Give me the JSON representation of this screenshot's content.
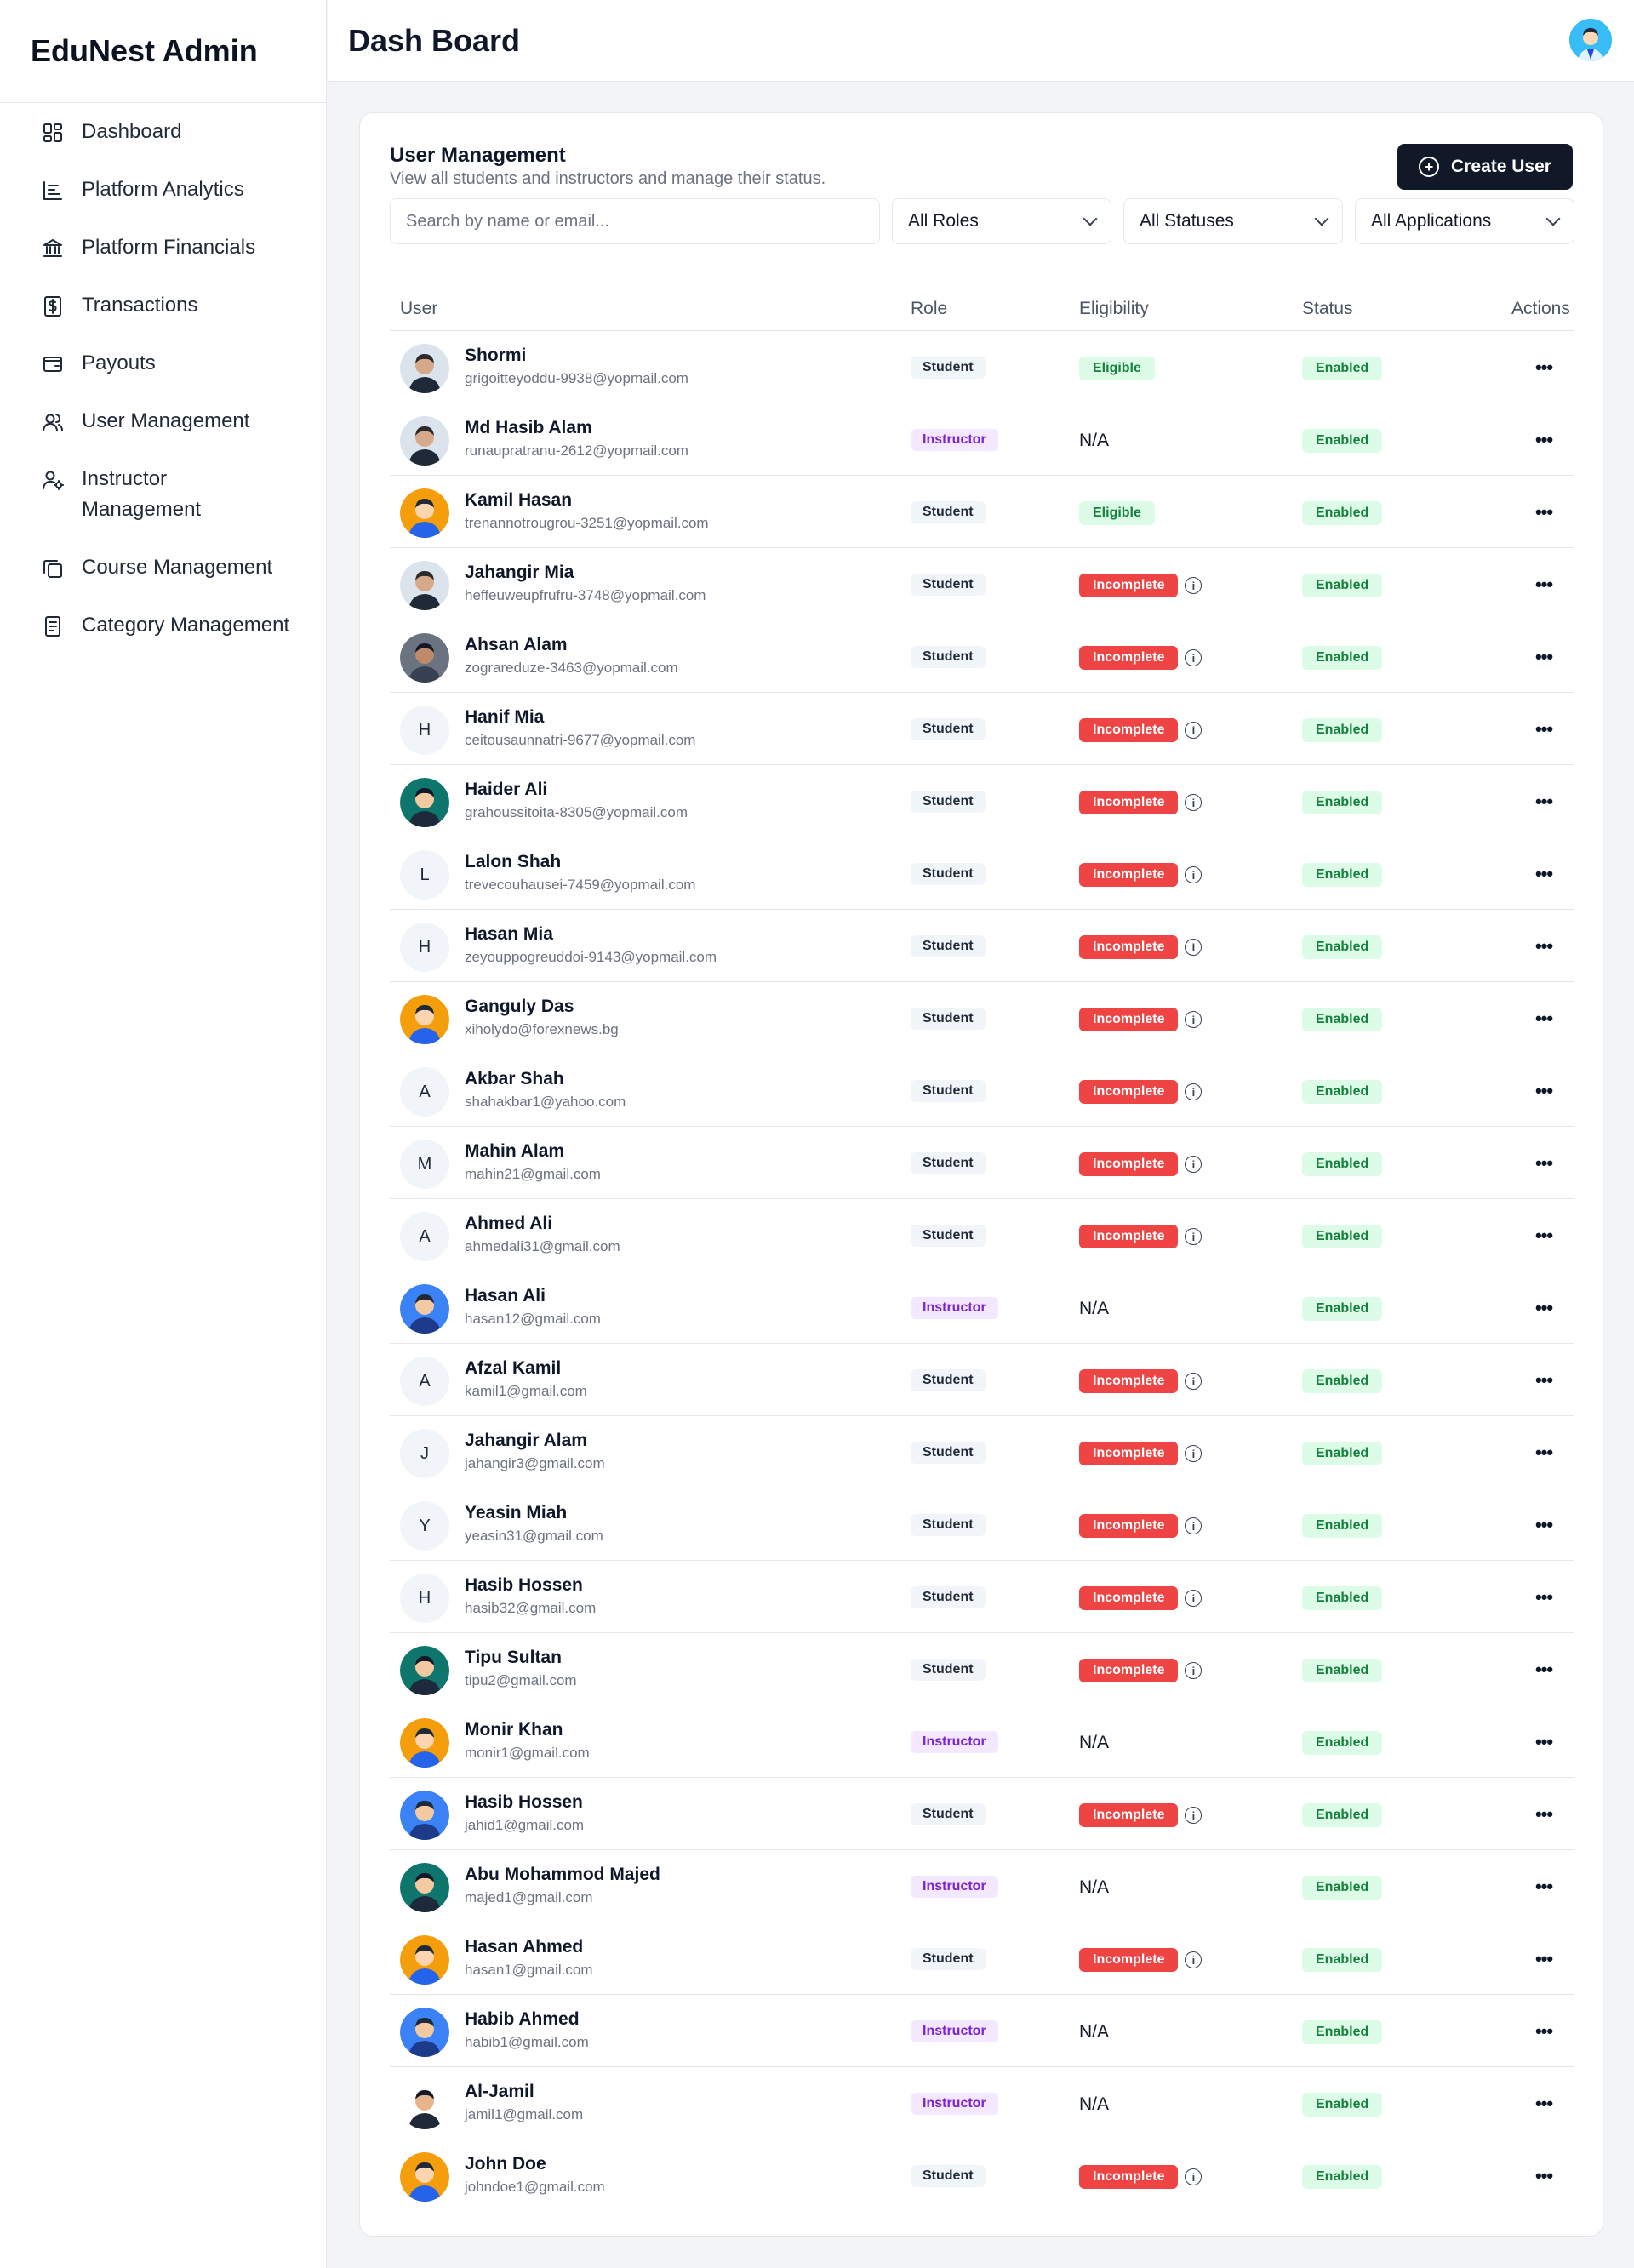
{
  "app": {
    "brand": "EduNest Admin",
    "page_title": "Dash Board"
  },
  "sidebar": {
    "items": [
      {
        "label": "Dashboard",
        "icon": "dashboard-icon"
      },
      {
        "label": "Platform Analytics",
        "icon": "analytics-icon"
      },
      {
        "label": "Platform Financials",
        "icon": "bank-icon"
      },
      {
        "label": "Transactions",
        "icon": "dollar-icon"
      },
      {
        "label": "Payouts",
        "icon": "wallet-icon"
      },
      {
        "label": "User Management",
        "icon": "users-icon"
      },
      {
        "label": "Instructor Management",
        "icon": "instructor-icon"
      },
      {
        "label": "Course Management",
        "icon": "copy-icon"
      },
      {
        "label": "Category Management",
        "icon": "list-icon"
      }
    ]
  },
  "card": {
    "title": "User Management",
    "subtitle": "View all students and instructors and manage their status.",
    "create_label": "Create User",
    "search_placeholder": "Search by name or email...",
    "filters": [
      "All Roles",
      "All Statuses",
      "All Applications"
    ],
    "columns": {
      "user": "User",
      "role": "Role",
      "eligibility": "Eligibility",
      "status": "Status",
      "actions": "Actions"
    }
  },
  "colors": {
    "primary": "#111827",
    "incomplete": "#ef4444",
    "eligible_bg": "#dcfce7",
    "eligible_fg": "#15803d",
    "instructor_bg": "#f3e8ff",
    "instructor_fg": "#7e22ce"
  },
  "users": [
    {
      "name": "Shormi",
      "email": "grigoitteyoddu-9938@yopmail.com",
      "role": "Student",
      "eligibility": "Eligible",
      "status": "Enabled",
      "avatar": "photo-male",
      "initial": ""
    },
    {
      "name": "Md Hasib Alam",
      "email": "runaupratranu-2612@yopmail.com",
      "role": "Instructor",
      "eligibility": "N/A",
      "status": "Enabled",
      "avatar": "photo-male",
      "initial": ""
    },
    {
      "name": "Kamil Hasan",
      "email": "trenannotrougrou-3251@yopmail.com",
      "role": "Student",
      "eligibility": "Eligible",
      "status": "Enabled",
      "avatar": "cartoon-orange",
      "initial": ""
    },
    {
      "name": "Jahangir Mia",
      "email": "heffeuweupfrufru-3748@yopmail.com",
      "role": "Student",
      "eligibility": "Incomplete",
      "status": "Enabled",
      "avatar": "photo-male",
      "initial": ""
    },
    {
      "name": "Ahsan Alam",
      "email": "zograreduze-3463@yopmail.com",
      "role": "Student",
      "eligibility": "Incomplete",
      "status": "Enabled",
      "avatar": "photo-dark",
      "initial": ""
    },
    {
      "name": "Hanif Mia",
      "email": "ceitousaunnatri-9677@yopmail.com",
      "role": "Student",
      "eligibility": "Incomplete",
      "status": "Enabled",
      "avatar": "initial",
      "initial": "H"
    },
    {
      "name": "Haider Ali",
      "email": "grahoussitoita-8305@yopmail.com",
      "role": "Student",
      "eligibility": "Incomplete",
      "status": "Enabled",
      "avatar": "cartoon-teal",
      "initial": ""
    },
    {
      "name": "Lalon Shah",
      "email": "trevecouhausei-7459@yopmail.com",
      "role": "Student",
      "eligibility": "Incomplete",
      "status": "Enabled",
      "avatar": "initial",
      "initial": "L"
    },
    {
      "name": "Hasan Mia",
      "email": "zeyouppogreuddoi-9143@yopmail.com",
      "role": "Student",
      "eligibility": "Incomplete",
      "status": "Enabled",
      "avatar": "initial",
      "initial": "H"
    },
    {
      "name": "Ganguly Das",
      "email": "xiholydo@forexnews.bg",
      "role": "Student",
      "eligibility": "Incomplete",
      "status": "Enabled",
      "avatar": "cartoon-orange",
      "initial": ""
    },
    {
      "name": "Akbar Shah",
      "email": "shahakbar1@yahoo.com",
      "role": "Student",
      "eligibility": "Incomplete",
      "status": "Enabled",
      "avatar": "initial",
      "initial": "A"
    },
    {
      "name": "Mahin Alam",
      "email": "mahin21@gmail.com",
      "role": "Student",
      "eligibility": "Incomplete",
      "status": "Enabled",
      "avatar": "initial",
      "initial": "M"
    },
    {
      "name": "Ahmed Ali",
      "email": "ahmedali31@gmail.com",
      "role": "Student",
      "eligibility": "Incomplete",
      "status": "Enabled",
      "avatar": "initial",
      "initial": "A"
    },
    {
      "name": "Hasan Ali",
      "email": "hasan12@gmail.com",
      "role": "Instructor",
      "eligibility": "N/A",
      "status": "Enabled",
      "avatar": "cartoon-blue",
      "initial": ""
    },
    {
      "name": "Afzal Kamil",
      "email": "kamil1@gmail.com",
      "role": "Student",
      "eligibility": "Incomplete",
      "status": "Enabled",
      "avatar": "initial",
      "initial": "A"
    },
    {
      "name": "Jahangir Alam",
      "email": "jahangir3@gmail.com",
      "role": "Student",
      "eligibility": "Incomplete",
      "status": "Enabled",
      "avatar": "initial",
      "initial": "J"
    },
    {
      "name": "Yeasin Miah",
      "email": "yeasin31@gmail.com",
      "role": "Student",
      "eligibility": "Incomplete",
      "status": "Enabled",
      "avatar": "initial",
      "initial": "Y"
    },
    {
      "name": "Hasib Hossen",
      "email": "hasib32@gmail.com",
      "role": "Student",
      "eligibility": "Incomplete",
      "status": "Enabled",
      "avatar": "initial",
      "initial": "H"
    },
    {
      "name": "Tipu Sultan",
      "email": "tipu2@gmail.com",
      "role": "Student",
      "eligibility": "Incomplete",
      "status": "Enabled",
      "avatar": "cartoon-teal",
      "initial": ""
    },
    {
      "name": "Monir Khan",
      "email": "monir1@gmail.com",
      "role": "Instructor",
      "eligibility": "N/A",
      "status": "Enabled",
      "avatar": "cartoon-orange",
      "initial": ""
    },
    {
      "name": "Hasib Hossen",
      "email": "jahid1@gmail.com",
      "role": "Student",
      "eligibility": "Incomplete",
      "status": "Enabled",
      "avatar": "cartoon-blue",
      "initial": ""
    },
    {
      "name": "Abu Mohammod Majed",
      "email": "majed1@gmail.com",
      "role": "Instructor",
      "eligibility": "N/A",
      "status": "Enabled",
      "avatar": "cartoon-teal",
      "initial": ""
    },
    {
      "name": "Hasan Ahmed",
      "email": "hasan1@gmail.com",
      "role": "Student",
      "eligibility": "Incomplete",
      "status": "Enabled",
      "avatar": "cartoon-orange",
      "initial": ""
    },
    {
      "name": "Habib Ahmed",
      "email": "habib1@gmail.com",
      "role": "Instructor",
      "eligibility": "N/A",
      "status": "Enabled",
      "avatar": "cartoon-blue",
      "initial": ""
    },
    {
      "name": "Al-Jamil",
      "email": "jamil1@gmail.com",
      "role": "Instructor",
      "eligibility": "N/A",
      "status": "Enabled",
      "avatar": "cartoon-white",
      "initial": ""
    },
    {
      "name": "John Doe",
      "email": "johndoe1@gmail.com",
      "role": "Student",
      "eligibility": "Incomplete",
      "status": "Enabled",
      "avatar": "cartoon-orange",
      "initial": ""
    }
  ]
}
